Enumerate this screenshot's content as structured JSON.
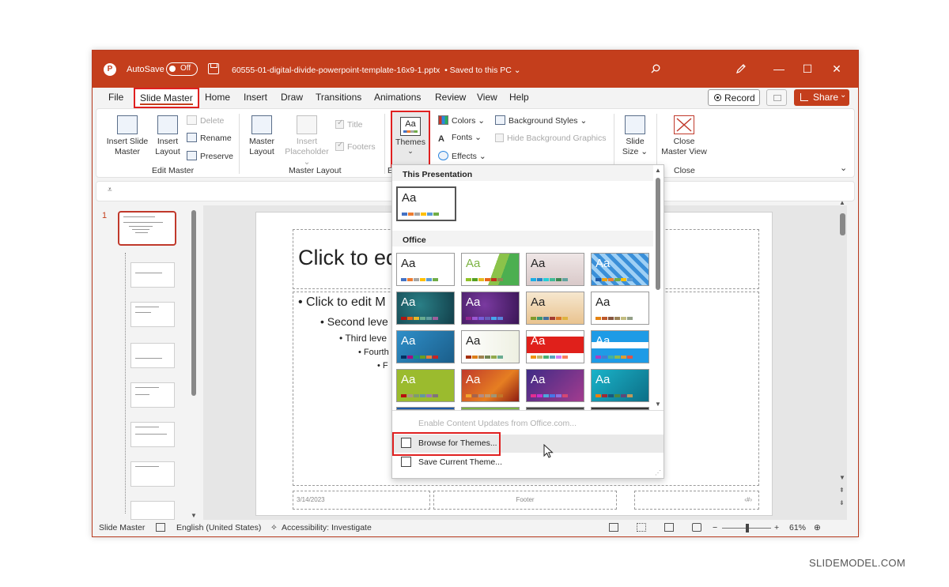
{
  "titlebar": {
    "autosave_label": "AutoSave",
    "autosave_state": "Off",
    "filename": "60555-01-digital-divide-powerpoint-template-16x9-1.pptx",
    "save_status": "• Saved to this PC ⌄",
    "app_logo_letter": "P"
  },
  "tabs": {
    "items": [
      "File",
      "Slide Master",
      "Home",
      "Insert",
      "Draw",
      "Transitions",
      "Animations",
      "Review",
      "View",
      "Help"
    ],
    "active": "Slide Master",
    "record_label": "Record",
    "share_label": "Share"
  },
  "ribbon": {
    "insert_slide_master": "Insert Slide Master",
    "insert_slide_master_l1": "Insert Slide",
    "insert_slide_master_l2": "Master",
    "insert_layout_l1": "Insert",
    "insert_layout_l2": "Layout",
    "delete": "Delete",
    "rename": "Rename",
    "preserve": "Preserve",
    "group_edit_master": "Edit Master",
    "master_layout_l1": "Master",
    "master_layout_l2": "Layout",
    "insert_placeholder_l1": "Insert",
    "insert_placeholder_l2": "Placeholder ⌄",
    "title_chk": "Title",
    "footers_chk": "Footers",
    "group_master_layout": "Master Layout",
    "group_e": "E",
    "themes": "Themes",
    "themes_caret": "⌄",
    "colors": "Colors ⌄",
    "fonts": "Fonts ⌄",
    "effects": "Effects ⌄",
    "background_styles": "Background Styles ⌄",
    "hide_background_graphics": "Hide Background Graphics",
    "slide_size_l1": "Slide",
    "slide_size_l2": "Size ⌄",
    "close_master_l1": "Close",
    "close_master_l2": "Master View",
    "group_close": "Close"
  },
  "thumbnails": {
    "master_number": "1"
  },
  "slide": {
    "title_text": "Click to ed",
    "body": [
      "• Click to edit M",
      "• Second leve",
      "• Third leve",
      "• Fourth",
      "• F"
    ],
    "footer_date": "3/14/2023",
    "footer_center": "Footer",
    "footer_num": "‹#›"
  },
  "dropdown": {
    "section_this": "This Presentation",
    "section_office": "Office",
    "tile_text": "Aa",
    "enable_updates": "Enable Content Updates from Office.com...",
    "browse_themes": "Browse for Themes...",
    "save_theme": "Save Current Theme..."
  },
  "statusbar": {
    "mode": "Slide Master",
    "language": "English (United States)",
    "accessibility": "Accessibility: Investigate",
    "zoom": "61%"
  },
  "watermark": "SLIDEMODEL.COM",
  "colors": {
    "accent": "#c43e1c",
    "highlight": "#e02020"
  }
}
